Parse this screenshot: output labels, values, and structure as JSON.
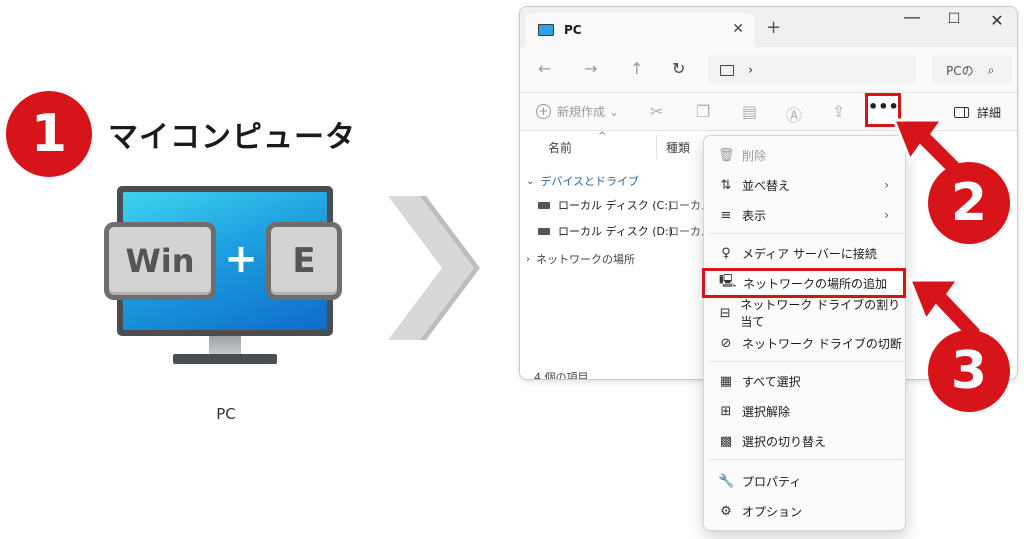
{
  "step1": {
    "number": "1",
    "title": "マイコンピュータ"
  },
  "keys": {
    "win": "Win",
    "plus": "+",
    "e": "E"
  },
  "pc_caption": "PC",
  "explorer": {
    "tab_title": "PC",
    "tab_close": "✕",
    "new_tab": "+",
    "window_controls": {
      "minimize": "—",
      "maximize": "☐",
      "close": "✕"
    },
    "nav": {
      "back": "←",
      "forward": "→",
      "up": "↑",
      "refresh": "↻",
      "address_sep": "›",
      "search_placeholder": "PCの"
    },
    "toolbar": {
      "new_label": "新規作成",
      "new_caret": "⌄",
      "more": "•••",
      "details": "詳細"
    },
    "columns": {
      "name": "名前",
      "type": "種類"
    },
    "groups": {
      "devices": "デバイスとドライブ",
      "network": "ネットワークの場所"
    },
    "drives": [
      {
        "name": "ローカル ディスク (C:)",
        "type": "ローカル"
      },
      {
        "name": "ローカル ディスク (D:)",
        "type": "ローカル"
      }
    ],
    "status": "4 個の項目"
  },
  "menu": {
    "items": [
      {
        "label": "削除",
        "icon": "trash-icon"
      },
      {
        "label": "並べ替え",
        "icon": "sort-icon"
      },
      {
        "label": "表示",
        "icon": "view-icon"
      },
      {
        "label": "メディア サーバーに接続",
        "icon": "media-server-icon"
      },
      {
        "label": "ネットワークの場所の追加",
        "icon": "network-location-icon"
      },
      {
        "label": "ネットワーク ドライブの割り当て",
        "icon": "map-drive-icon"
      },
      {
        "label": "ネットワーク ドライブの切断",
        "icon": "disconnect-drive-icon"
      },
      {
        "label": "すべて選択",
        "icon": "select-all-icon"
      },
      {
        "label": "選択解除",
        "icon": "select-none-icon"
      },
      {
        "label": "選択の切り替え",
        "icon": "invert-selection-icon"
      },
      {
        "label": "プロパティ",
        "icon": "properties-icon"
      },
      {
        "label": "オプション",
        "icon": "options-icon"
      }
    ],
    "submenu_arrow": "›"
  },
  "callouts": {
    "two": "2",
    "three": "3"
  },
  "colors": {
    "accent_red": "#d7141a",
    "screen_blue": "#1c9fe0"
  }
}
